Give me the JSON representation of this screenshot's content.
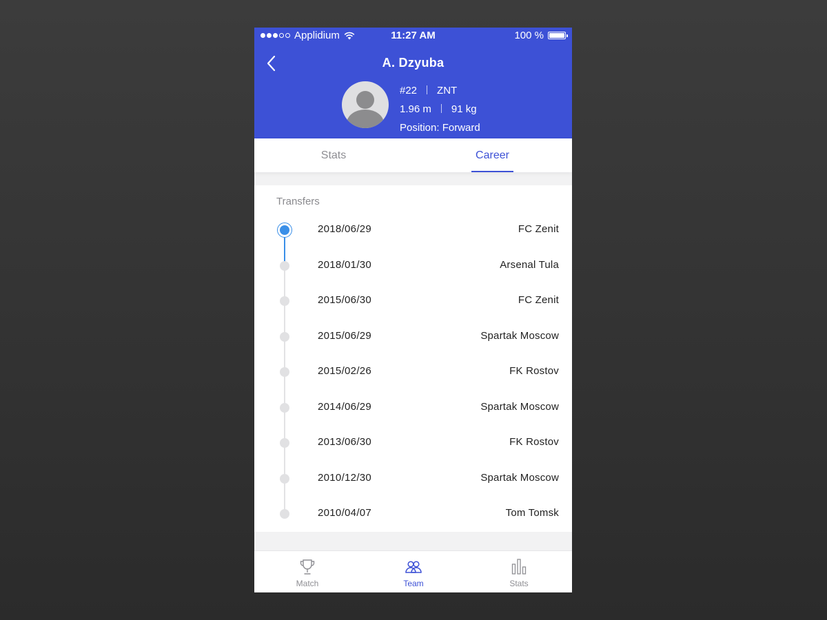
{
  "status_bar": {
    "carrier": "Applidium",
    "time": "11:27 AM",
    "battery": "100 %"
  },
  "header": {
    "player_name": "A. Dzyuba",
    "number": "#22",
    "team": "ZNT",
    "height": "1.96 m",
    "weight": "91 kg",
    "position": "Position: Forward"
  },
  "tabs": {
    "stats": "Stats",
    "career": "Career",
    "active": "Career"
  },
  "transfers": {
    "title": "Transfers",
    "items": [
      {
        "date": "2018/06/29",
        "club": "FC Zenit"
      },
      {
        "date": "2018/01/30",
        "club": "Arsenal Tula"
      },
      {
        "date": "2015/06/30",
        "club": "FC Zenit"
      },
      {
        "date": "2015/06/29",
        "club": "Spartak Moscow"
      },
      {
        "date": "2015/02/26",
        "club": "FK Rostov"
      },
      {
        "date": "2014/06/29",
        "club": "Spartak Moscow"
      },
      {
        "date": "2013/06/30",
        "club": "FK Rostov"
      },
      {
        "date": "2010/12/30",
        "club": "Spartak Moscow"
      },
      {
        "date": "2010/04/07",
        "club": "Tom Tomsk"
      }
    ]
  },
  "tab_bar": {
    "match": "Match",
    "team": "Team",
    "stats": "Stats",
    "active": "Team"
  },
  "colors": {
    "brand": "#3d51d6",
    "timeline_active": "#3a8fe8",
    "inactive": "#8e8e93"
  }
}
